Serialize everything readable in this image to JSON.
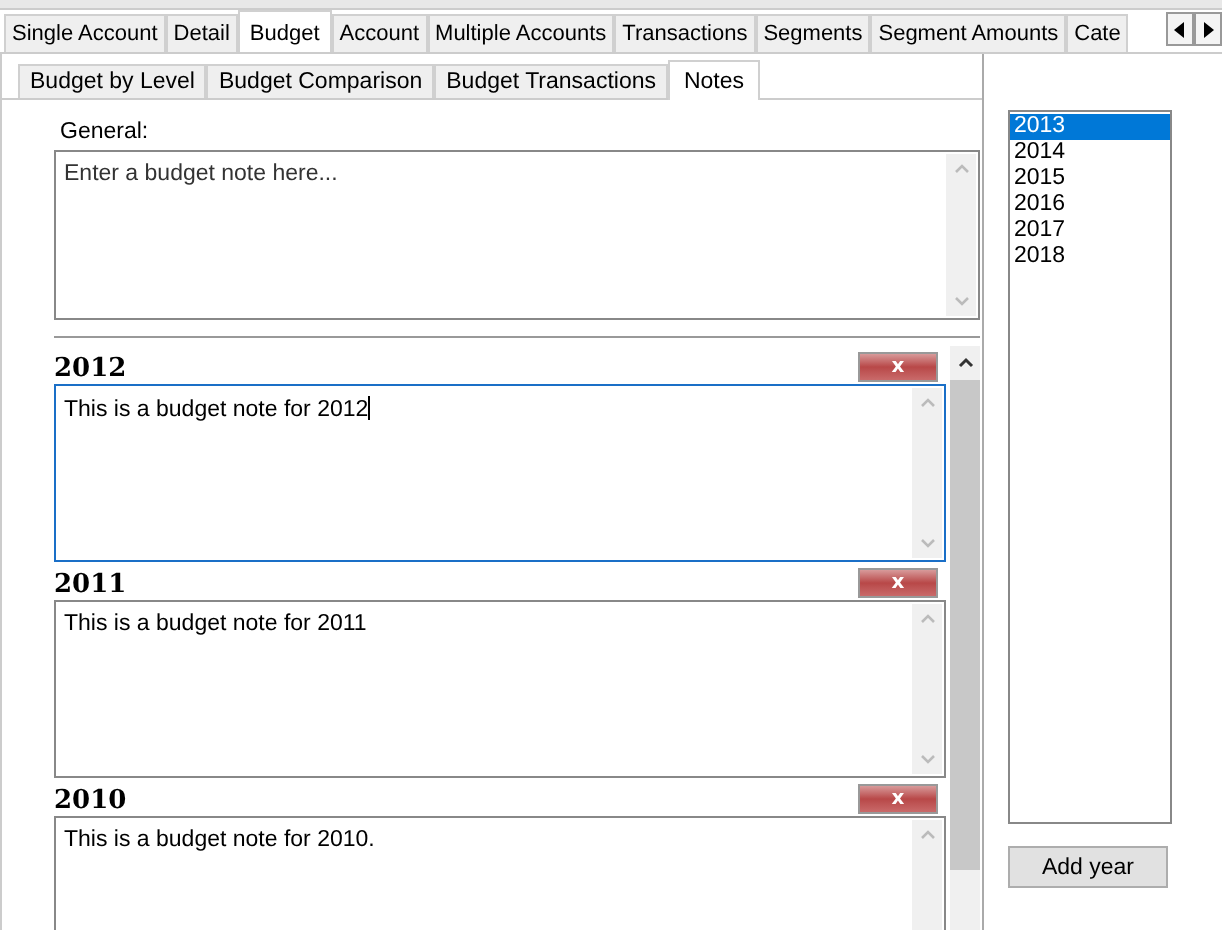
{
  "tabs": [
    {
      "label": "Single Account",
      "selected": false
    },
    {
      "label": "Detail",
      "selected": false
    },
    {
      "label": "Budget",
      "selected": true
    },
    {
      "label": "Account",
      "selected": false
    },
    {
      "label": "Multiple Accounts",
      "selected": false
    },
    {
      "label": "Transactions",
      "selected": false
    },
    {
      "label": "Segments",
      "selected": false
    },
    {
      "label": "Segment Amounts",
      "selected": false
    },
    {
      "label": "Cate",
      "selected": false
    }
  ],
  "subtabs": [
    {
      "label": "Budget by Level",
      "selected": false
    },
    {
      "label": "Budget Comparison",
      "selected": false
    },
    {
      "label": "Budget Transactions",
      "selected": false
    },
    {
      "label": "Notes",
      "selected": true
    }
  ],
  "general": {
    "label": "General:",
    "placeholder": "Enter a budget note here..."
  },
  "notes": [
    {
      "year": "2012",
      "delete": "x",
      "value": "This is a budget note for 2012",
      "focused": true
    },
    {
      "year": "2011",
      "delete": "x",
      "value": "This is a budget note for 2011",
      "focused": false
    },
    {
      "year": "2010",
      "delete": "x",
      "value": "This is a budget note for 2010.",
      "focused": false
    }
  ],
  "years": [
    {
      "label": "2013",
      "selected": true
    },
    {
      "label": "2014",
      "selected": false
    },
    {
      "label": "2015",
      "selected": false
    },
    {
      "label": "2016",
      "selected": false
    },
    {
      "label": "2017",
      "selected": false
    },
    {
      "label": "2018",
      "selected": false
    }
  ],
  "add_button": "Add year"
}
